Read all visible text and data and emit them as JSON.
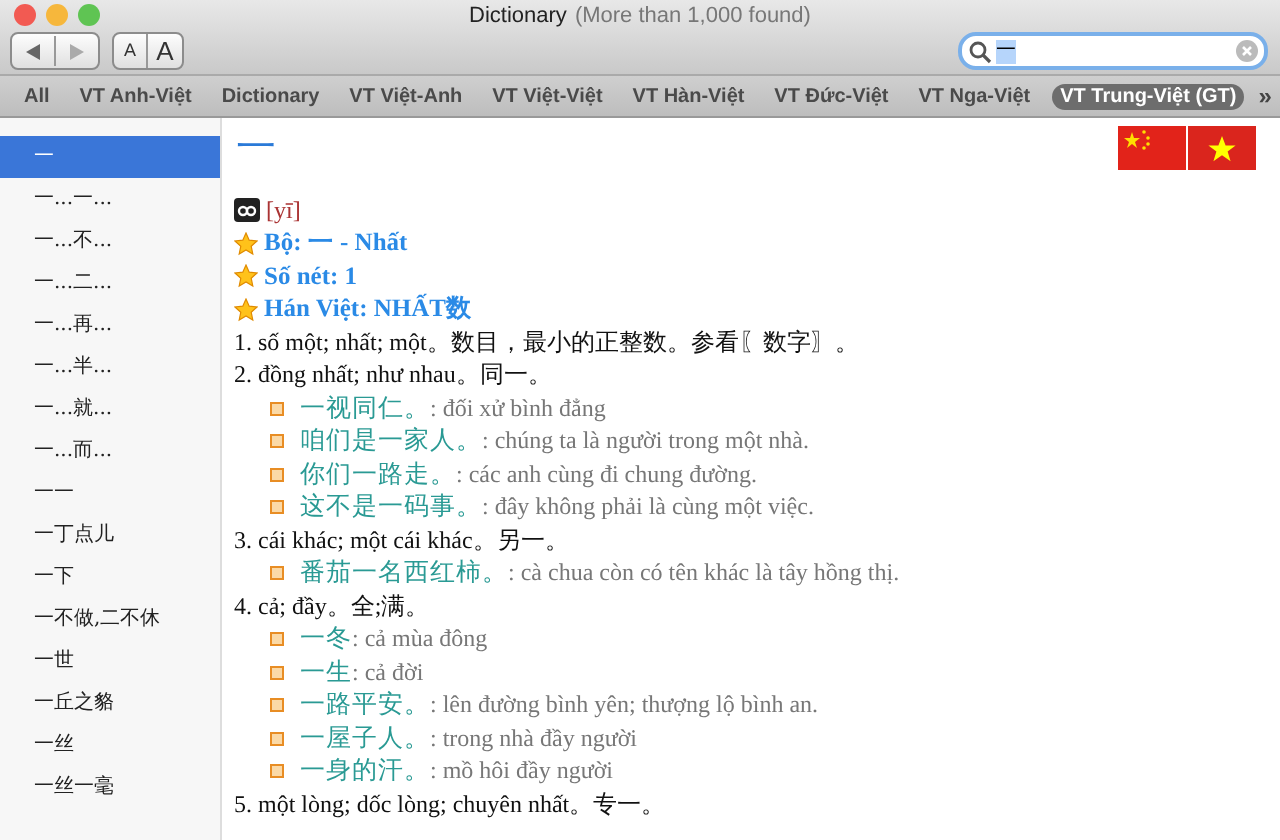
{
  "window": {
    "title": "Dictionary",
    "subtitle": "(More than 1,000 found)"
  },
  "toolbar": {
    "font_buttons": [
      "A",
      "A"
    ],
    "search": {
      "value": "一"
    }
  },
  "tabs": [
    {
      "label": "All",
      "selected": false
    },
    {
      "label": "VT Anh-Việt",
      "selected": false
    },
    {
      "label": "Dictionary",
      "selected": false
    },
    {
      "label": "VT Việt-Anh",
      "selected": false
    },
    {
      "label": "VT Việt-Việt",
      "selected": false
    },
    {
      "label": "VT Hàn-Việt",
      "selected": false
    },
    {
      "label": "VT Đức-Việt",
      "selected": false
    },
    {
      "label": "VT Nga-Việt",
      "selected": false
    },
    {
      "label": "VT Trung-Việt (GT)",
      "selected": true
    }
  ],
  "tabs_overflow": "»",
  "sidebar": {
    "items": [
      {
        "label": "一",
        "selected": true
      },
      {
        "label": "一...一...",
        "selected": false
      },
      {
        "label": "一...不...",
        "selected": false
      },
      {
        "label": "一...二...",
        "selected": false
      },
      {
        "label": "一...再...",
        "selected": false
      },
      {
        "label": "一...半...",
        "selected": false
      },
      {
        "label": "一...就...",
        "selected": false
      },
      {
        "label": "一...而...",
        "selected": false
      },
      {
        "label": "一一",
        "selected": false
      },
      {
        "label": "一丁点儿",
        "selected": false
      },
      {
        "label": "一下",
        "selected": false
      },
      {
        "label": "一不做,二不休",
        "selected": false
      },
      {
        "label": "一世",
        "selected": false
      },
      {
        "label": "一丘之貉",
        "selected": false
      },
      {
        "label": "一丝",
        "selected": false
      },
      {
        "label": "一丝一毫",
        "selected": false
      }
    ]
  },
  "entry": {
    "headword": "一",
    "pronunciation": "[yī]",
    "facts": [
      "Bộ: 一 - Nhất",
      "Số nét: 1",
      "Hán Việt: NHẤT数"
    ],
    "senses": [
      {
        "text": "1. số một; nhất; một。数目，最小的正整数。参看〖数字〗。"
      },
      {
        "text": "2. đồng nhất; như nhau。同一。",
        "examples": [
          {
            "zh": "一视同仁。",
            "vi": ": đối xử bình đẳng"
          },
          {
            "zh": "咱们是一家人。",
            "vi": ": chúng ta là người trong một nhà."
          },
          {
            "zh": "你们一路走。",
            "vi": ": các anh cùng đi chung đường."
          },
          {
            "zh": "这不是一码事。",
            "vi": ": đây không phải là cùng một việc."
          }
        ]
      },
      {
        "text": "3. cái khác; một cái khác。另一。",
        "examples": [
          {
            "zh": "番茄一名西红柿。",
            "vi": ": cà chua còn có tên khác là tây hồng thị."
          }
        ]
      },
      {
        "text": "4. cả; đầy。全;满。",
        "examples": [
          {
            "zh": "一冬",
            "vi": ": cả mùa đông"
          },
          {
            "zh": "一生",
            "vi": ": cả đời"
          },
          {
            "zh": "一路平安。",
            "vi": ": lên đường bình yên; thượng lộ bình an."
          },
          {
            "zh": "一屋子人。",
            "vi": ": trong nhà đầy người"
          },
          {
            "zh": "一身的汗。",
            "vi": ": mồ hôi đầy người"
          }
        ]
      },
      {
        "text": "5. một lòng; dốc lòng; chuyên nhất。专一。"
      }
    ]
  }
}
